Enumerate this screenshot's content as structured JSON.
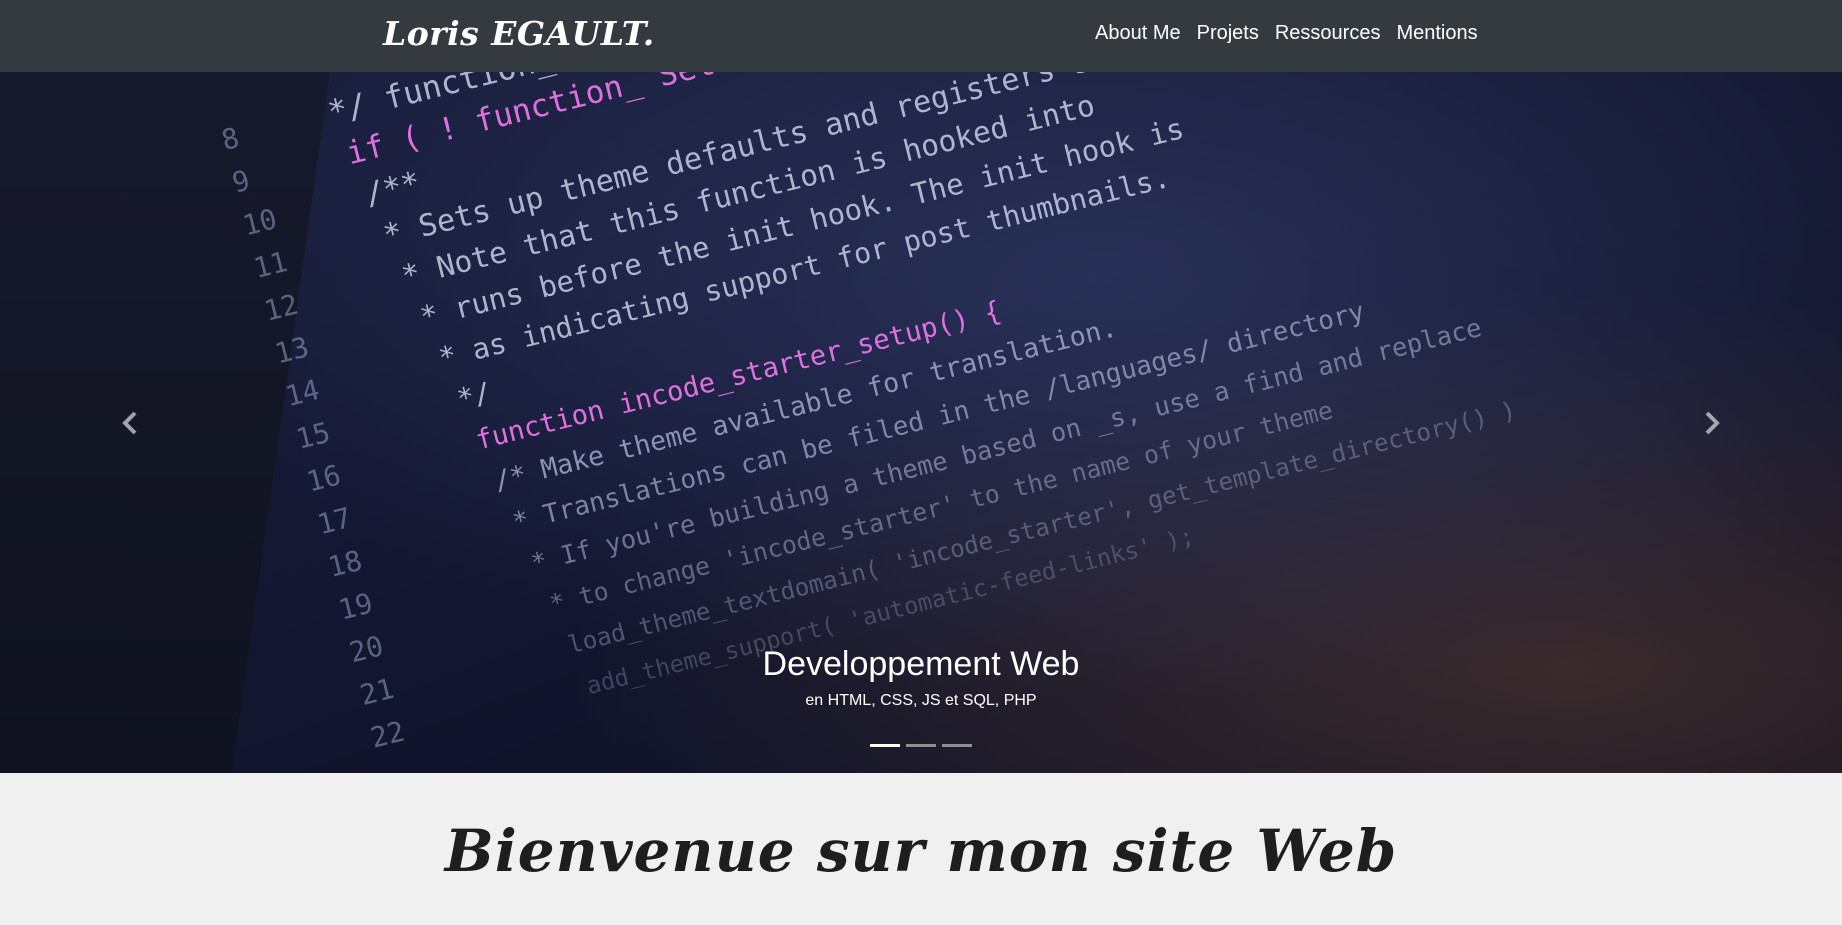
{
  "navbar": {
    "brand": "Loris EGAULT.",
    "links": [
      "About Me",
      "Projets",
      "Ressources",
      "Mentions"
    ]
  },
  "carousel": {
    "caption_title": "Developpement Web",
    "caption_text": "en HTML, CSS, JS et SQL, PHP",
    "slide_count": 3,
    "active_slide": 1,
    "prev_icon": "chevron-left-icon",
    "next_icon": "chevron-right-icon",
    "code_lines": [
      {
        "n": "8",
        "t": "*/  function_"
      },
      {
        "n": "9",
        "t": "if ( ! function_ Sets up theme defaults an"
      },
      {
        "n": "10",
        "t": "/**"
      },
      {
        "n": "11",
        "t": "* Sets up theme defaults and registers support"
      },
      {
        "n": "12",
        "t": "* Note that this function is hooked into"
      },
      {
        "n": "13",
        "t": "* runs before the init hook. The init hook is"
      },
      {
        "n": "14",
        "t": "* as indicating support for post thumbnails."
      },
      {
        "n": "15",
        "t": "*/"
      },
      {
        "n": "16",
        "t": "function incode_starter_setup() {"
      },
      {
        "n": "17",
        "t": "/* Make theme available for translation."
      },
      {
        "n": "18",
        "t": "* Translations can be filed in the /languages/ directory"
      },
      {
        "n": "19",
        "t": "* If you're building a theme based on _s, use a find and replace"
      },
      {
        "n": "20",
        "t": "* to change 'incode_starter' to the name of your theme"
      },
      {
        "n": "21",
        "t": "load_theme_textdomain( 'incode_starter', get_template_directory() )"
      },
      {
        "n": "22",
        "t": "add_theme_support( 'automatic-feed-links' );"
      }
    ]
  },
  "welcome": {
    "title": "Bienvenue sur mon site Web"
  },
  "colors": {
    "navbar_bg": "#343a40",
    "page_bg": "#f0f0f0",
    "heading": "#1e1e1e"
  }
}
